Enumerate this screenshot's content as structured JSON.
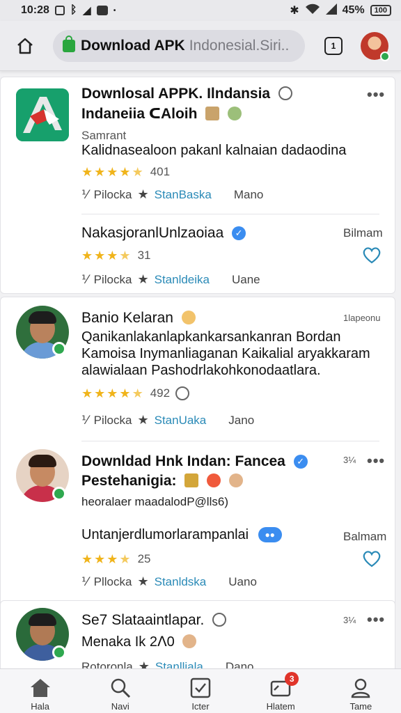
{
  "status": {
    "time": "10:28",
    "battery": "45%",
    "battery_icon_text": "100"
  },
  "browser": {
    "url_bold": "Download APK",
    "url_rest": "Indonesial.Siri..",
    "tabs_count": "1"
  },
  "card1": {
    "title_line1": "Downlosal APPK. Ilndansia",
    "title_line2": "Indaneiia ᑕAloih",
    "subtitle": "Samrant",
    "description": "Kalidnasealoon pakanl kalnaian dadaodina",
    "rating_count": "401",
    "action_pick": "Pilocka",
    "action_link": "StanBaska",
    "action_more": "Mano",
    "reply": {
      "title": "NakasjoranlUnlzaoiaa",
      "right": "Bilmam",
      "rating_count": "31",
      "action_pick": "Pilocka",
      "action_link": "Stanldeika",
      "action_more": "Uane"
    }
  },
  "card2": {
    "post1": {
      "title": "Banio Kelaran",
      "time": "1lapeonu",
      "line1": "Qanikanlakanlapkankarsankanran Bordan",
      "line2": "Kamoisa Inymanliaganan Kaikalial aryakkaram",
      "line3": "alawialaan Pashodrlakohkonodaatlara.",
      "rating_count": "492",
      "action_pick": "Pilocka",
      "action_link": "StanUaka",
      "action_more": "Jano"
    },
    "post2": {
      "title": "Downldad Hnk Indan: Fancea",
      "time": "3¼",
      "title_line2": "Pestehanigia:",
      "handle": "heoralaer maadalodP@lls6)",
      "reply_title": "Untanjerdlumorlarampanlai",
      "reply_right": "Balmam",
      "rating_count": "25",
      "action_pick": "Pllocka",
      "action_link": "Stanldska",
      "action_more": "Uano"
    }
  },
  "card3": {
    "title": "Se7 Slataaintlapar.",
    "time": "3¼",
    "line2": "Menaka Ik 2ᐱ0",
    "line3_left": "Rotoronla",
    "line3_link": "Stanlliala",
    "line3_right": "Dano"
  },
  "nav": {
    "items": [
      "Hala",
      "Navi",
      "Icter",
      "Hlatem",
      "Tame"
    ],
    "badge": "3"
  },
  "colors": {
    "accent_link": "#2a8ab7",
    "star": "#f0b41b",
    "verified": "#3b8df0",
    "badge_red": "#e0342a",
    "online_green": "#2fa84f"
  }
}
